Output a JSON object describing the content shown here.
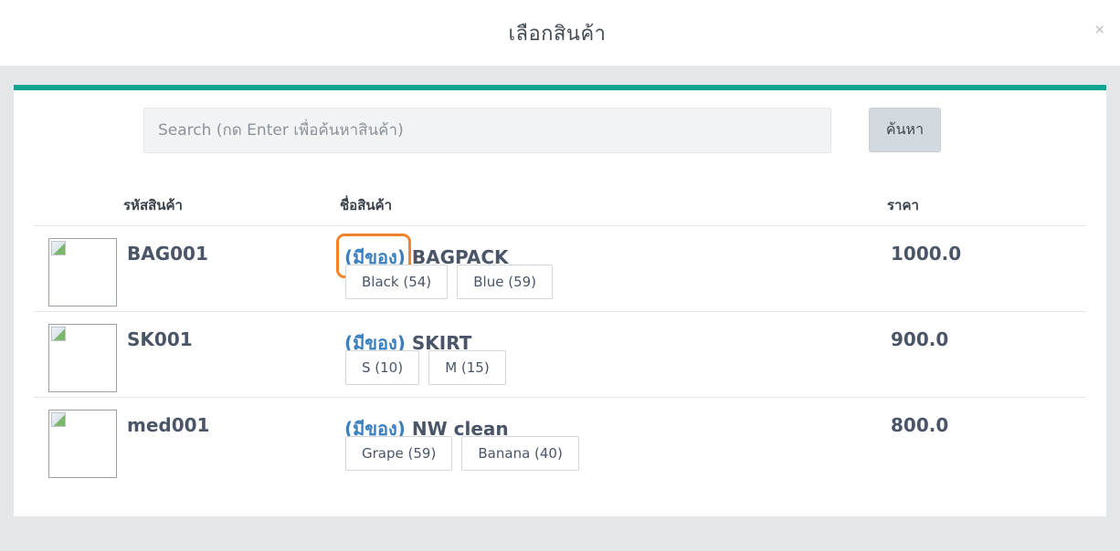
{
  "modal": {
    "title": "เลือกสินค้า",
    "close_icon": "×"
  },
  "search": {
    "placeholder": "Search (กด Enter เพื่อค้นหาสินค้า)",
    "value": "",
    "button_label": "ค้นหา"
  },
  "table": {
    "headers": {
      "code": "รหัสสินค้า",
      "name": "ชื่อสินค้า",
      "price": "ราคา"
    },
    "rows": [
      {
        "code": "BAG001",
        "stock_label": "(มีของ)",
        "name": "BAGPACK",
        "variants": [
          "Black (54)",
          "Blue (59)"
        ],
        "price": "1000.0"
      },
      {
        "code": "SK001",
        "stock_label": "(มีของ)",
        "name": "SKIRT",
        "variants": [
          "S (10)",
          "M (15)"
        ],
        "price": "900.0"
      },
      {
        "code": "med001",
        "stock_label": "(มีของ)",
        "name": "NW clean",
        "variants": [
          "Grape (59)",
          "Banana (40)"
        ],
        "price": "800.0"
      }
    ]
  },
  "colors": {
    "accent": "#10a593",
    "stock_link": "#3a80c0",
    "highlight": "#f0842a"
  }
}
